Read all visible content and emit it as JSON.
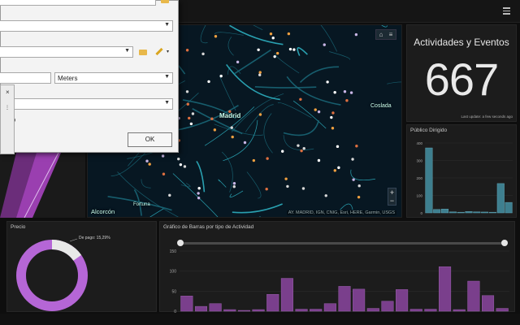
{
  "dashboard": {
    "map": {
      "labels": {
        "madrid": "Madrid",
        "coslada": "Coslada",
        "alcorcon": "Alcorcón",
        "fortuna": "Fortuna"
      },
      "attribution": "AY. MADRID, IGN, CNIG, Esri, HERE, Garmin, USGS",
      "zoom_in": "+",
      "zoom_out": "−"
    },
    "kpi": {
      "title": "Actividades y Eventos",
      "value": "667",
      "note": "Last update: a few seconds ago"
    },
    "histogram": {
      "title": "Público Dirigido",
      "color": "#3e7f8f"
    },
    "donut": {
      "title": "Precio",
      "legend": "De pago: 15,29%",
      "paid_fraction": 0.1529,
      "color": "#b566d6",
      "rest_color": "#e8e8e8"
    },
    "barchart": {
      "title": "Gráfico de Barras por tipo de Actividad",
      "color": "#7a3f8c"
    }
  },
  "dialog": {
    "unit_value": "Meters",
    "partial_label": "nship",
    "ok_label": "OK"
  },
  "chart_data": [
    {
      "type": "bar",
      "title": "Público Dirigido",
      "yticks": [
        "0",
        "100",
        "200",
        "300",
        "400"
      ],
      "ylim": [
        0,
        400
      ],
      "values": [
        372,
        20,
        22,
        6,
        4,
        8,
        6,
        5,
        4,
        168,
        60
      ]
    },
    {
      "type": "bar",
      "title": "Gráfico de Barras por tipo de Actividad",
      "yticks": [
        "0",
        "50",
        "100",
        "150"
      ],
      "ylim": [
        0,
        150
      ],
      "values": [
        38,
        12,
        19,
        4,
        2,
        4,
        42,
        82,
        5,
        5,
        19,
        62,
        55,
        7,
        25,
        54,
        5,
        5,
        111,
        4,
        75,
        39,
        7
      ]
    }
  ]
}
